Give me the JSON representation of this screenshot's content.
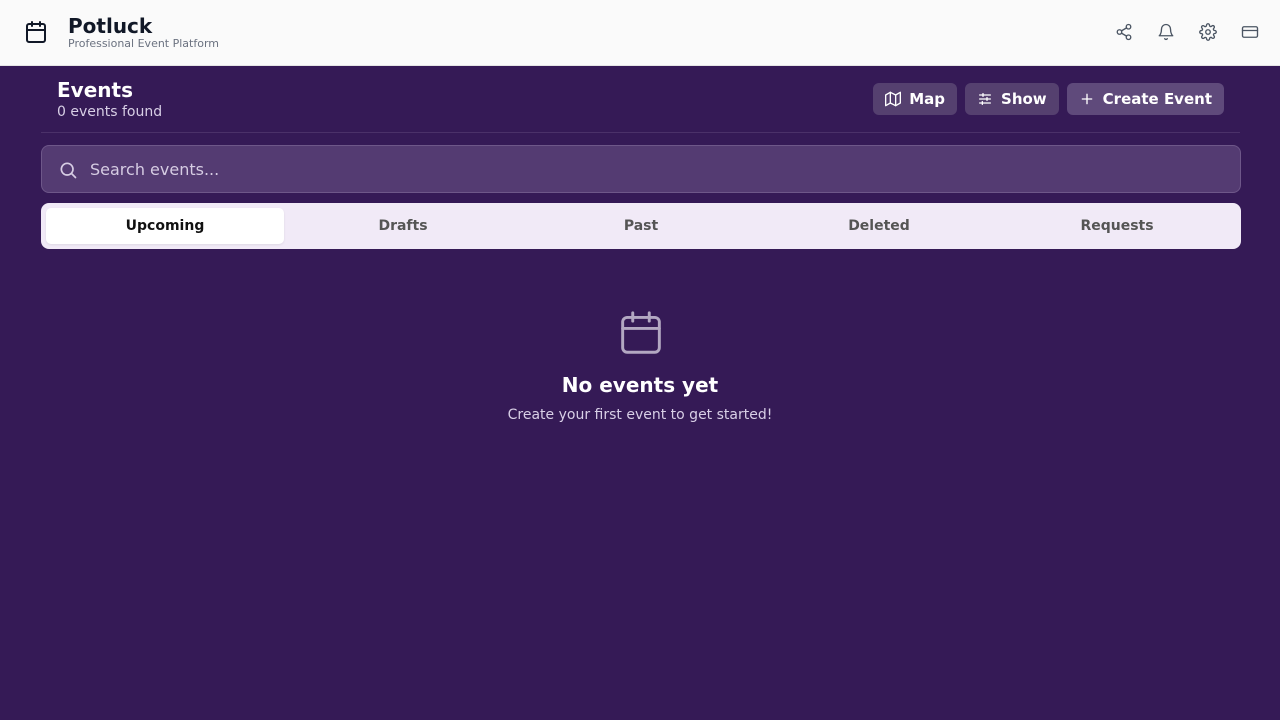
{
  "app": {
    "title": "Potluck",
    "subtitle": "Professional Event Platform",
    "icon": "calendar-icon"
  },
  "topbar": {
    "icons": [
      "share-icon",
      "bell-icon",
      "gear-icon",
      "credit-card-icon"
    ]
  },
  "header": {
    "title": "Events",
    "count_text": "0 events found",
    "map_label": "Map",
    "show_label": "Show",
    "create_label": "Create Event"
  },
  "search": {
    "placeholder": "Search events...",
    "value": ""
  },
  "tabs": [
    {
      "label": "Upcoming",
      "active": true
    },
    {
      "label": "Drafts",
      "active": false
    },
    {
      "label": "Past",
      "active": false
    },
    {
      "label": "Deleted",
      "active": false
    },
    {
      "label": "Requests",
      "active": false
    }
  ],
  "empty_state": {
    "icon": "calendar-icon",
    "title": "No events yet",
    "subtitle": "Create your first event to get started!"
  },
  "colors": {
    "background": "#351a56",
    "topbar": "#fafafa",
    "button": "#55406f",
    "tabs_bg": "#f1eaf7"
  }
}
